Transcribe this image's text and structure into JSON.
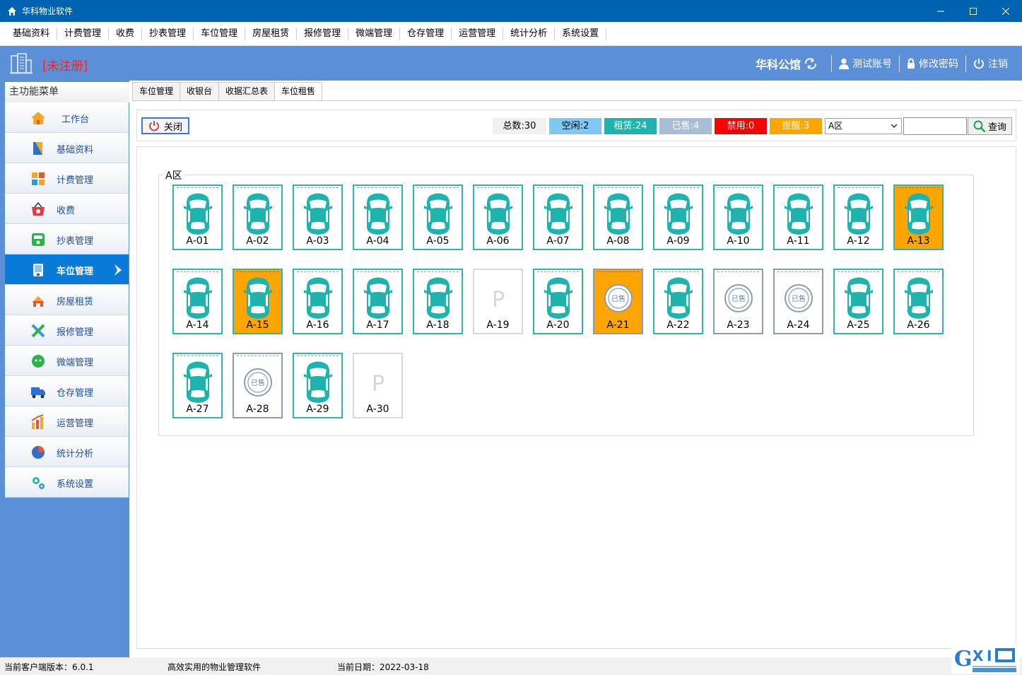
{
  "window": {
    "title": "华科物业软件"
  },
  "menubar": [
    "基础资料",
    "计费管理",
    "收费",
    "抄表管理",
    "车位管理",
    "房屋租赁",
    "报修管理",
    "微端管理",
    "仓存管理",
    "运营管理",
    "统计分析",
    "系统设置"
  ],
  "header": {
    "unregistered": "[未注册]",
    "org": "华科公馆",
    "account": "测试账号",
    "change_password": "修改密码",
    "logout": "注销"
  },
  "sidebar": {
    "title": "主功能菜单",
    "items": [
      {
        "label": "工作台",
        "icon": "house-icon"
      },
      {
        "label": "基础资料",
        "icon": "book-icon"
      },
      {
        "label": "计费管理",
        "icon": "calculator-icon"
      },
      {
        "label": "收费",
        "icon": "basket-icon"
      },
      {
        "label": "抄表管理",
        "icon": "meter-icon"
      },
      {
        "label": "车位管理",
        "icon": "parking-icon",
        "active": true
      },
      {
        "label": "房屋租赁",
        "icon": "building-icon"
      },
      {
        "label": "报修管理",
        "icon": "tools-icon"
      },
      {
        "label": "微端管理",
        "icon": "wechat-icon"
      },
      {
        "label": "仓存管理",
        "icon": "truck-icon"
      },
      {
        "label": "运营管理",
        "icon": "chart-bars-icon"
      },
      {
        "label": "统计分析",
        "icon": "pie-icon"
      },
      {
        "label": "系统设置",
        "icon": "gear-icon"
      }
    ]
  },
  "tabs": [
    "车位管理",
    "收银台",
    "收据汇总表",
    "车位租售"
  ],
  "active_tab": 3,
  "toolbar": {
    "close_label": "关闭",
    "total": "总数:30",
    "idle": "空闲:2",
    "rented": "租赁:24",
    "sold": "已售:4",
    "disabled": "禁用:0",
    "reminder": "提醒:3",
    "zone_selected": "A区",
    "search_value": "",
    "search_label": "查询"
  },
  "colors": {
    "idle": "#7ec8f3",
    "rented": "#1fb3ad",
    "sold": "#a9bcd6",
    "disabled": "#ff0000",
    "reminder": "#ffa500"
  },
  "area": {
    "label": "A区",
    "slots": [
      {
        "id": "A-01",
        "status": "rented"
      },
      {
        "id": "A-02",
        "status": "rented"
      },
      {
        "id": "A-03",
        "status": "rented"
      },
      {
        "id": "A-04",
        "status": "rented"
      },
      {
        "id": "A-05",
        "status": "rented"
      },
      {
        "id": "A-06",
        "status": "rented"
      },
      {
        "id": "A-07",
        "status": "rented"
      },
      {
        "id": "A-08",
        "status": "rented"
      },
      {
        "id": "A-09",
        "status": "rented"
      },
      {
        "id": "A-10",
        "status": "rented"
      },
      {
        "id": "A-11",
        "status": "rented"
      },
      {
        "id": "A-12",
        "status": "rented"
      },
      {
        "id": "A-13",
        "status": "rented",
        "reminder": true
      },
      {
        "id": "A-14",
        "status": "rented"
      },
      {
        "id": "A-15",
        "status": "rented",
        "reminder": true
      },
      {
        "id": "A-16",
        "status": "rented"
      },
      {
        "id": "A-17",
        "status": "rented"
      },
      {
        "id": "A-18",
        "status": "rented"
      },
      {
        "id": "A-19",
        "status": "idle"
      },
      {
        "id": "A-20",
        "status": "rented"
      },
      {
        "id": "A-21",
        "status": "sold",
        "reminder": true
      },
      {
        "id": "A-22",
        "status": "rented"
      },
      {
        "id": "A-23",
        "status": "sold"
      },
      {
        "id": "A-24",
        "status": "sold"
      },
      {
        "id": "A-25",
        "status": "rented"
      },
      {
        "id": "A-26",
        "status": "rented"
      },
      {
        "id": "A-27",
        "status": "rented"
      },
      {
        "id": "A-28",
        "status": "sold"
      },
      {
        "id": "A-29",
        "status": "rented"
      },
      {
        "id": "A-30",
        "status": "idle"
      }
    ],
    "idle_mark": "P",
    "sold_stamp": "已售"
  },
  "statusbar": {
    "version": "当前客户端版本：6.0.1",
    "slogan": "高效实用的物业管理软件",
    "date": "当前日期：2022-03-18"
  }
}
